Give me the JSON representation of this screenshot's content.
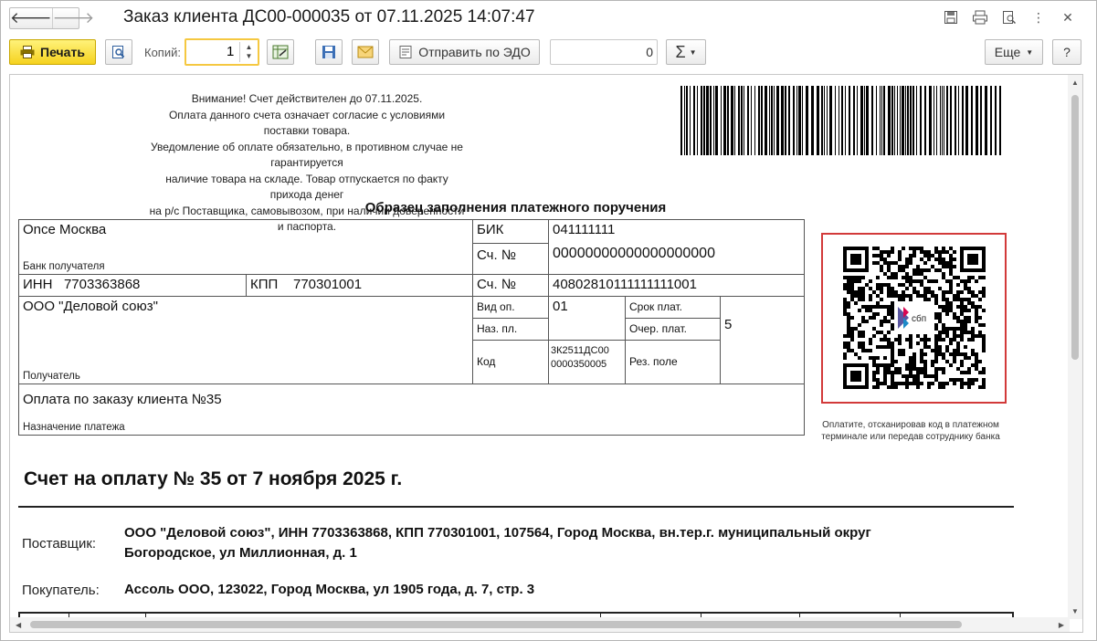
{
  "window": {
    "title": "Заказ клиента ДС00-000035 от 07.11.2025 14:07:47"
  },
  "nav": {
    "back_icon": "arrow-left-icon",
    "forward_icon": "arrow-right-icon",
    "back_glyph": "🡐",
    "forward_glyph": "🡒"
  },
  "title_icons": {
    "save": "💾",
    "print": "🖶",
    "preview": "🔍",
    "menu": "⋮",
    "close": "✕"
  },
  "toolbar": {
    "print_label": "Печать",
    "copies_label": "Копий:",
    "copies_value": "1",
    "send_edo_label": "Отправить по ЭДО",
    "number_value": "0",
    "sum_label": "Σ",
    "more_label": "Еще",
    "help_label": "?"
  },
  "document": {
    "notice_lines": [
      "Внимание! Счет действителен до 07.11.2025.",
      "Оплата данного счета означает согласие с условиями поставки товара.",
      "Уведомление об оплате обязательно, в противном случае не гарантируется",
      "наличие товара на складе. Товар отпускается по факту прихода денег",
      "на р/с Поставщика, самовывозом, при наличии доверенности и паспорта."
    ],
    "sample_title": "Образец заполнения платежного поручения",
    "payment": {
      "bank_name": "Onсе Москва",
      "bank_caption": "Банк получателя",
      "bik_label": "БИК",
      "bik_value": "041111111",
      "acc1_label": "Сч. №",
      "acc1_value": "00000000000000000000",
      "inn_label": "ИНН",
      "inn_value": "7703363868",
      "kpp_label": "КПП",
      "kpp_value": "770301001",
      "acc2_label": "Сч. №",
      "acc2_value": "40802810111111111001",
      "recipient_name": "ООО \"Деловой союз\"",
      "recipient_caption": "Получатель",
      "vid_op_label": "Вид оп.",
      "vid_op_value": "01",
      "srok_label": "Срок плат.",
      "naz_label": "Наз. пл.",
      "ocher_label": "Очер. плат.",
      "ocher_value": "5",
      "kod_label": "Код",
      "kod_value_1": "3К2511ДС00",
      "kod_value_2": "0000350005",
      "rez_label": "Рез. поле",
      "purpose_value": "Оплата по заказу клиента №35",
      "purpose_caption": "Назначение платежа"
    },
    "qr_badge": "сбп",
    "qr_caption_1": "Оплатите, отсканировав код в платежном",
    "qr_caption_2": "терминале или передав сотруднику банка",
    "invoice_title": "Счет на оплату № 35 от 7 ноября 2025 г.",
    "supplier_label": "Поставщик:",
    "supplier_value_1": "ООО \"Деловой союз\", ИНН 7703363868, КПП 770301001, 107564, Город Москва, вн.тер.г. муниципальный округ",
    "supplier_value_2": "Богородское, ул Миллионная, д. 1",
    "buyer_label": "Покупатель:",
    "buyer_value": "Ассоль ООО, 123022, Город Москва, ул 1905 года, д. 7, стр. 3"
  }
}
